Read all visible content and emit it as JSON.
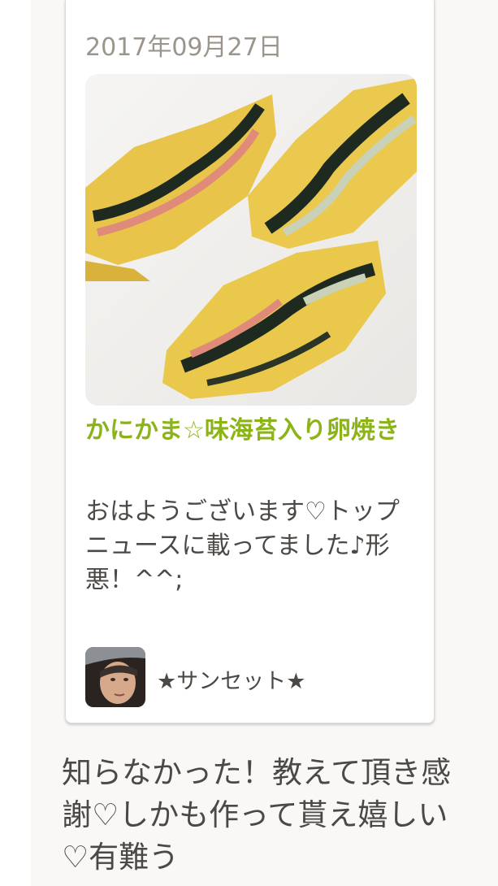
{
  "recipe_card": {
    "date": "2017年09月27日",
    "photo_icon": "tamagoyaki-photo",
    "title": "かにかま☆味海苔入り卵焼き",
    "description": "おはようございます♡トップニュースに載ってました♪形悪！^^;",
    "author": {
      "avatar_icon": "author-avatar-image",
      "name": "★サンセット★"
    }
  },
  "comment": {
    "text": "知らなかった！教えて頂き感謝♡しかも作って貰え嬉しい♡有難う"
  },
  "colors": {
    "title": "#8cb418",
    "date": "#9b958c",
    "body_text": "#4b4845",
    "page_background": "#f9f8f6"
  }
}
